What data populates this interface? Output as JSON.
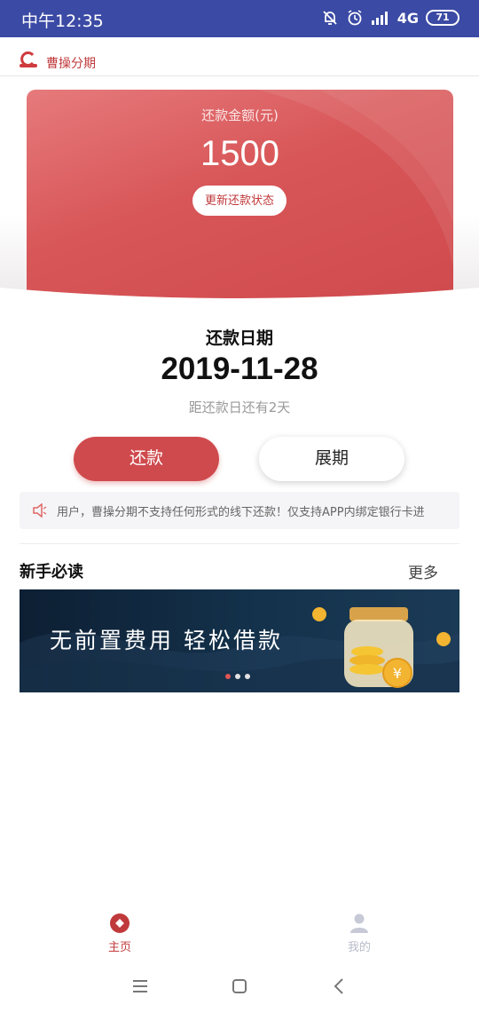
{
  "status_bar": {
    "time": "中午12:35",
    "network": "4G",
    "battery": "71",
    "icons": [
      "mute-icon",
      "alarm-icon",
      "signal-icon",
      "battery-icon"
    ]
  },
  "app": {
    "brand_name": "曹操分期",
    "brand_color": "#c0393b",
    "header_color": "#3b4aa4"
  },
  "repayment_card": {
    "title": "还款金额(元)",
    "amount": "1500",
    "refresh_button": "更新还款状态",
    "card_color": "#d85658"
  },
  "due": {
    "label": "还款日期",
    "date": "2019-11-28",
    "countdown": "距还款日还有2天"
  },
  "actions": {
    "repay": "还款",
    "extend": "展期"
  },
  "notice": {
    "icon": "speaker-icon",
    "text": "用户，曹操分期不支持任何形式的线下还款！仅支持APP内绑定银行卡进"
  },
  "guide": {
    "title": "新手必读",
    "more": "更多"
  },
  "banner": {
    "slogan": "无前置费用  轻松借款",
    "slides_total": 3,
    "active_slide": 1
  },
  "tabbar": {
    "items": [
      {
        "label": "主页",
        "icon": "home-icon",
        "active": true
      },
      {
        "label": "我的",
        "icon": "profile-icon",
        "active": false
      }
    ]
  },
  "system_nav": {
    "icons": [
      "menu-icon",
      "home-square-icon",
      "back-icon"
    ]
  }
}
